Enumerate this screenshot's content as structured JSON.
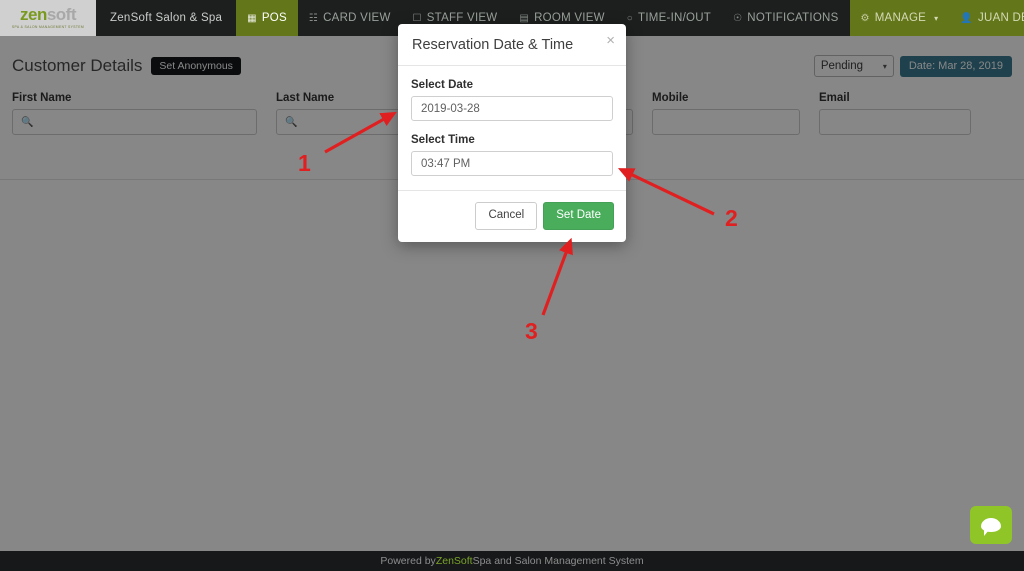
{
  "navbar": {
    "brand": {
      "word_primary": "zen",
      "word_secondary": "soft",
      "tagline": "SPA & SALON MANAGEMENT SYSTEM"
    },
    "site_name": "ZenSoft Salon & Spa",
    "items": [
      {
        "label": "POS",
        "icon": "cash-register-icon",
        "active": true
      },
      {
        "label": "CARD VIEW",
        "icon": "card-view-icon",
        "active": false
      },
      {
        "label": "STAFF VIEW",
        "icon": "staff-view-icon",
        "active": false
      },
      {
        "label": "ROOM VIEW",
        "icon": "room-view-icon",
        "active": false
      },
      {
        "label": "TIME-IN/OUT",
        "icon": "clock-icon",
        "active": false
      },
      {
        "label": "NOTIFICATIONS",
        "icon": "bell-icon",
        "active": false
      }
    ],
    "manage": {
      "label": "MANAGE",
      "icon": "gear-icon",
      "caret": "▾"
    },
    "user": {
      "label": "JUAN DELA CRUZ",
      "icon": "user-icon",
      "caret": "▾"
    }
  },
  "header": {
    "title": "Customer Details",
    "set_anonymous_label": "Set Anonymous",
    "status_value": "Pending",
    "status_caret": "▾",
    "date_badge": "Date: Mar 28, 2019"
  },
  "fields": [
    {
      "label": "First Name",
      "value": "",
      "icon": "search-icon",
      "type": "search"
    },
    {
      "label": "Last Name",
      "value": "",
      "icon": "search-icon",
      "type": "search"
    },
    {
      "label": "",
      "value": "",
      "icon": "chevron-down-icon",
      "type": "select"
    },
    {
      "label": "Mobile",
      "value": "",
      "icon": "",
      "type": "text"
    },
    {
      "label": "Email",
      "value": "",
      "icon": "",
      "type": "text"
    }
  ],
  "modal": {
    "title": "Reservation Date & Time",
    "close_glyph": "×",
    "date_label": "Select Date",
    "date_value": "2019-03-28",
    "time_label": "Select Time",
    "time_value": "03:47 PM",
    "cancel_label": "Cancel",
    "submit_label": "Set Date"
  },
  "annotations": [
    {
      "number": "1",
      "target": "select-date-input"
    },
    {
      "number": "2",
      "target": "select-time-input"
    },
    {
      "number": "3",
      "target": "set-date-button"
    }
  ],
  "footer": {
    "prefix": "Powered by ",
    "brand": "ZenSoft",
    "suffix": " Spa and Salon Management System"
  },
  "chat_widget": {
    "icon": "chat-bubble-icon"
  },
  "colors": {
    "nav_bg": "#1d1f1f",
    "accent_green": "#63761a",
    "button_green": "#4aad5c",
    "badge_teal": "#3a7c92",
    "annotation_red": "#e02020",
    "chat_green": "#8fc527"
  }
}
